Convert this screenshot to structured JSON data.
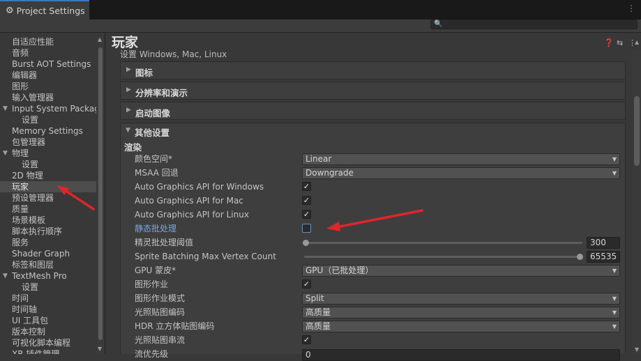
{
  "window": {
    "tab_title": "Project Settings",
    "menu_icon": "kebab-menu-icon"
  },
  "search": {
    "placeholder": ""
  },
  "sidebar": {
    "items": [
      {
        "label": "自适应性能",
        "indent": false,
        "foldout": false
      },
      {
        "label": "音频",
        "indent": false,
        "foldout": false
      },
      {
        "label": "Burst AOT Settings",
        "indent": false,
        "foldout": false
      },
      {
        "label": "编辑器",
        "indent": false,
        "foldout": false
      },
      {
        "label": "图形",
        "indent": false,
        "foldout": false
      },
      {
        "label": "输入管理器",
        "indent": false,
        "foldout": false
      },
      {
        "label": "Input System Packag",
        "indent": false,
        "foldout": true
      },
      {
        "label": "设置",
        "indent": true,
        "foldout": false
      },
      {
        "label": "Memory Settings",
        "indent": false,
        "foldout": false
      },
      {
        "label": "包管理器",
        "indent": false,
        "foldout": false
      },
      {
        "label": "物理",
        "indent": false,
        "foldout": true
      },
      {
        "label": "设置",
        "indent": true,
        "foldout": false
      },
      {
        "label": "2D 物理",
        "indent": false,
        "foldout": false
      },
      {
        "label": "玩家",
        "indent": false,
        "foldout": false,
        "selected": true
      },
      {
        "label": "预设管理器",
        "indent": false,
        "foldout": false
      },
      {
        "label": "质量",
        "indent": false,
        "foldout": false
      },
      {
        "label": "场景模板",
        "indent": false,
        "foldout": false
      },
      {
        "label": "脚本执行顺序",
        "indent": false,
        "foldout": false
      },
      {
        "label": "服务",
        "indent": false,
        "foldout": false
      },
      {
        "label": "Shader Graph",
        "indent": false,
        "foldout": false
      },
      {
        "label": "标签和图层",
        "indent": false,
        "foldout": false
      },
      {
        "label": "TextMesh Pro",
        "indent": false,
        "foldout": true
      },
      {
        "label": "设置",
        "indent": true,
        "foldout": false
      },
      {
        "label": "时间",
        "indent": false,
        "foldout": false
      },
      {
        "label": "时间轴",
        "indent": false,
        "foldout": false
      },
      {
        "label": "UI 工具包",
        "indent": false,
        "foldout": false
      },
      {
        "label": "版本控制",
        "indent": false,
        "foldout": false
      },
      {
        "label": "可视化脚本编程",
        "indent": false,
        "foldout": false
      },
      {
        "label": "XR 插件管理",
        "indent": false,
        "foldout": false
      }
    ]
  },
  "main": {
    "title": "玩家",
    "subtitle": "设置 Windows, Mac, Linux",
    "foldouts": [
      "图标",
      "分辨率和演示",
      "启动图像"
    ],
    "other_settings": "其他设置",
    "render_section": "渲染",
    "rows": [
      {
        "label": "颜色空间*",
        "type": "dropdown",
        "value": "Linear"
      },
      {
        "label": "MSAA 回退",
        "type": "dropdown",
        "value": "Downgrade"
      },
      {
        "label": "Auto Graphics API  for Windows",
        "type": "checkbox",
        "checked": true
      },
      {
        "label": "Auto Graphics API  for Mac",
        "type": "checkbox",
        "checked": true
      },
      {
        "label": "Auto Graphics API  for Linux",
        "type": "checkbox",
        "checked": true
      },
      {
        "label": "静态批处理",
        "type": "checkbox",
        "checked": false,
        "highlight": true
      },
      {
        "label": "精灵批处理阈值",
        "type": "slider",
        "value": "300",
        "fraction": 0.0
      },
      {
        "label": "Sprite Batching Max Vertex Count",
        "type": "slider",
        "value": "65535",
        "fraction": 1.0
      },
      {
        "label": "GPU 蒙皮*",
        "type": "dropdown",
        "value": "GPU（已批处理）"
      },
      {
        "label": "图形作业",
        "type": "checkbox",
        "checked": true
      },
      {
        "label": "图形作业模式",
        "type": "dropdown",
        "value": "Split"
      },
      {
        "label": "光照贴图编码",
        "type": "dropdown",
        "value": "高质量"
      },
      {
        "label": "HDR 立方体贴图编码",
        "type": "dropdown",
        "value": "高质量"
      },
      {
        "label": "光照贴图串流",
        "type": "checkbox",
        "checked": true
      },
      {
        "label": "流优先级",
        "type": "number",
        "value": "0"
      }
    ]
  },
  "colors": {
    "accent": "#3a79bb",
    "annotation_arrow": "#e0252b",
    "highlight_label": "#7ba6df"
  }
}
